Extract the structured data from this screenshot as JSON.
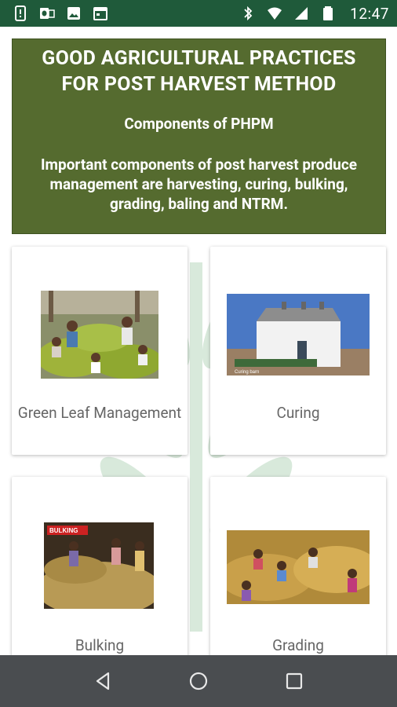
{
  "status_bar": {
    "time": "12:47",
    "left_icons": [
      "phone-alert-icon",
      "outlook-icon",
      "image-icon",
      "calendar-icon"
    ],
    "right_icons": [
      "bluetooth-icon",
      "wifi-icon",
      "signal-icon",
      "battery-icon"
    ]
  },
  "header": {
    "title": "GOOD AGRICULTURAL PRACTICES FOR POST HARVEST METHOD",
    "subtitle": "Components of PHPM",
    "description": "Important components of post harvest produce management are harvesting, curing, bulking, grading, baling and NTRM."
  },
  "cards": [
    {
      "label": "Green Leaf Management",
      "image": "green-leaf-photo"
    },
    {
      "label": "Curing",
      "image": "curing-barn-photo"
    },
    {
      "label": "Bulking",
      "image": "bulking-photo"
    },
    {
      "label": "Grading",
      "image": "grading-photo"
    }
  ],
  "nav": {
    "buttons": [
      "back",
      "home",
      "recents"
    ]
  },
  "colors": {
    "status_bar": "#1f5a3a",
    "header_bg": "#556b2f",
    "nav_bar": "#4a4d50"
  }
}
